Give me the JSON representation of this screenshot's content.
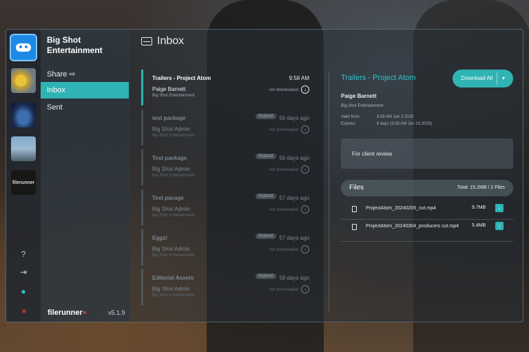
{
  "workspace": {
    "name": "Big Shot Entertainment",
    "workspace_labels": [
      "filerunner"
    ]
  },
  "nav": {
    "share": "Share ⇨",
    "inbox": "Inbox",
    "sent": "Sent"
  },
  "footer": {
    "brand": "filerunner",
    "version": "v5.1.9"
  },
  "inbox": {
    "title": "Inbox",
    "packages": [
      {
        "title": "Trailers - Project Atom",
        "time": "9:58 AM",
        "from": "Paige Barnett",
        "org": "Big Shot Entertainment",
        "status": "not downloaded",
        "badge": ""
      },
      {
        "title": "test package",
        "time": "56 days ago",
        "from": "Big Shot Admin",
        "org": "Big Shot Entertainment",
        "status": "not downloaded",
        "badge": "Expired"
      },
      {
        "title": "Test package",
        "time": "56 days ago",
        "from": "Big Shot Admin",
        "org": "Big Shot Entertainment",
        "status": "not downloaded",
        "badge": "Expired"
      },
      {
        "title": "Test pacage",
        "time": "57 days ago",
        "from": "Big Shot Admin",
        "org": "Big Shot Entertainment",
        "status": "not downloaded",
        "badge": "Expired"
      },
      {
        "title": "Eggs!",
        "time": "57 days ago",
        "from": "Big Shot Admin",
        "org": "Big Shot Entertainment",
        "status": "not downloaded",
        "badge": "Expired"
      },
      {
        "title": "Editorial Assets",
        "time": "58 days ago",
        "from": "Big Shot Admin",
        "org": "Big Shot Entertainment",
        "status": "not downloaded",
        "badge": "Expired"
      }
    ]
  },
  "detail": {
    "title": "Trailers - Project Atom",
    "download_all": "Download All",
    "sender": "Paige Barnett",
    "org": "Big Shot Entertainment",
    "valid_label": "Valid from:",
    "valid_value": "9:58 AM Jun 3 2025",
    "expires_label": "Expires:",
    "expires_value": "6 days (9:53 AM Jun 13 2025)",
    "note": "For client review",
    "files_label": "Files",
    "files_total": "Total: 15.2MB / 2 Files",
    "files": [
      {
        "name": "ProjectAtom_20240205_cut.mp4",
        "size": "9.7MB"
      },
      {
        "name": "ProjectAtom_20240304_producers cut.mp4",
        "size": "5.4MB"
      }
    ]
  },
  "colors": {
    "accent": "#2fb3b4",
    "brand_red": "#ff3b2f",
    "workspace_blue": "#1f8ae6"
  },
  "icons": {
    "help": "help-icon",
    "logout": "logout-icon",
    "user": "user-icon",
    "inbox": "inbox-icon",
    "download": "download-icon",
    "file": "file-icon"
  }
}
